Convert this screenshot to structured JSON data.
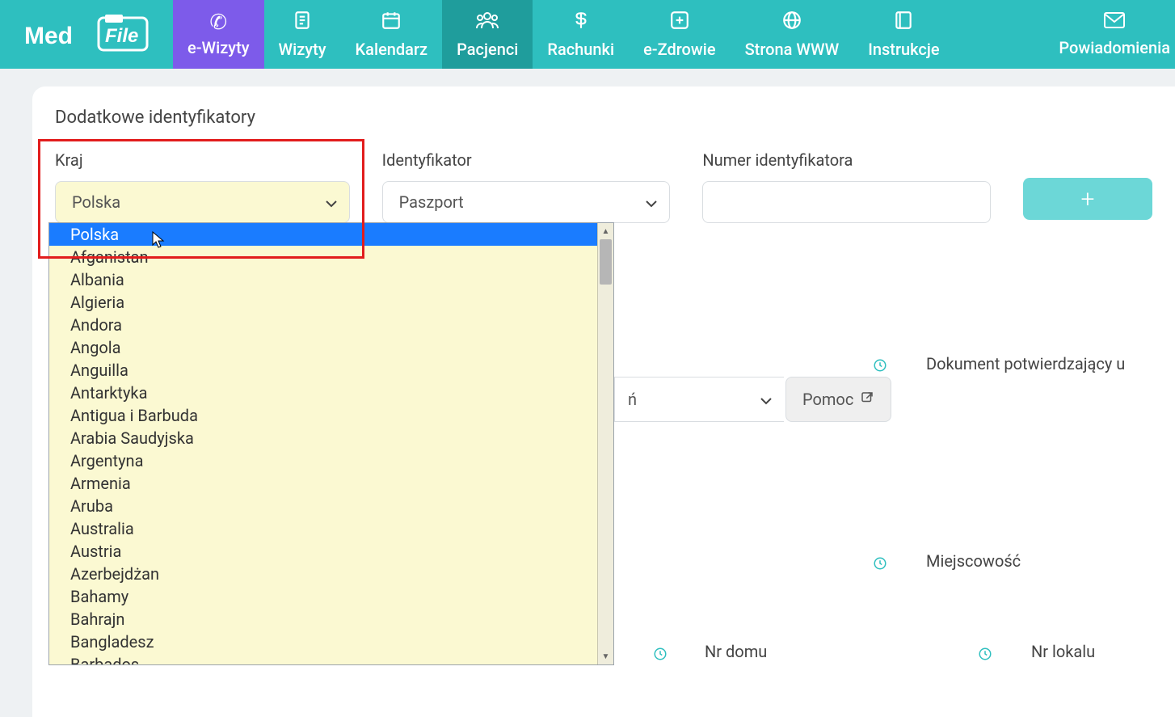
{
  "logo": {
    "part1": "Med",
    "part2": "File"
  },
  "nav": {
    "items": [
      {
        "label": "e-Wizyty",
        "icon": "phone"
      },
      {
        "label": "Wizyty",
        "icon": "clipboard"
      },
      {
        "label": "Kalendarz",
        "icon": "calendar"
      },
      {
        "label": "Pacjenci",
        "icon": "people"
      },
      {
        "label": "Rachunki",
        "icon": "dollar"
      },
      {
        "label": "e-Zdrowie",
        "icon": "plus-box"
      },
      {
        "label": "Strona WWW",
        "icon": "globe"
      },
      {
        "label": "Instrukcje",
        "icon": "book"
      }
    ],
    "right": {
      "label": "Powiadomienia",
      "icon": "mail"
    }
  },
  "section": {
    "title": "Dodatkowe identyfikatory"
  },
  "form": {
    "country": {
      "label": "Kraj",
      "value": "Polska"
    },
    "identifier": {
      "label": "Identyfikator",
      "value": "Paszport"
    },
    "identifier_number": {
      "label": "Numer identyfikatora",
      "value": ""
    },
    "add_button_label": "+"
  },
  "dropdown": {
    "selected_index": 0,
    "options": [
      "Polska",
      "Afganistan",
      "Albania",
      "Algieria",
      "Andora",
      "Angola",
      "Anguilla",
      "Antarktyka",
      "Antigua i Barbuda",
      "Arabia Saudyjska",
      "Argentyna",
      "Armenia",
      "Aruba",
      "Australia",
      "Austria",
      "Azerbejdżan",
      "Bahamy",
      "Bahrajn",
      "Bangladesz",
      "Barbados"
    ]
  },
  "right_side": {
    "doc_label": "Dokument potwierdzający u",
    "select_suffix": "ń",
    "help_label": "Pomoc",
    "city_label": "Miejscowość",
    "house_label": "Nr domu",
    "flat_label": "Nr lokalu"
  },
  "colors": {
    "teal": "#2ebfbf",
    "purple": "#7d5bea",
    "teal_dark": "#1f9d9c",
    "highlight": "#e21d1d",
    "dropdown_bg": "#fbf9d2",
    "blue": "#1a7cff"
  }
}
